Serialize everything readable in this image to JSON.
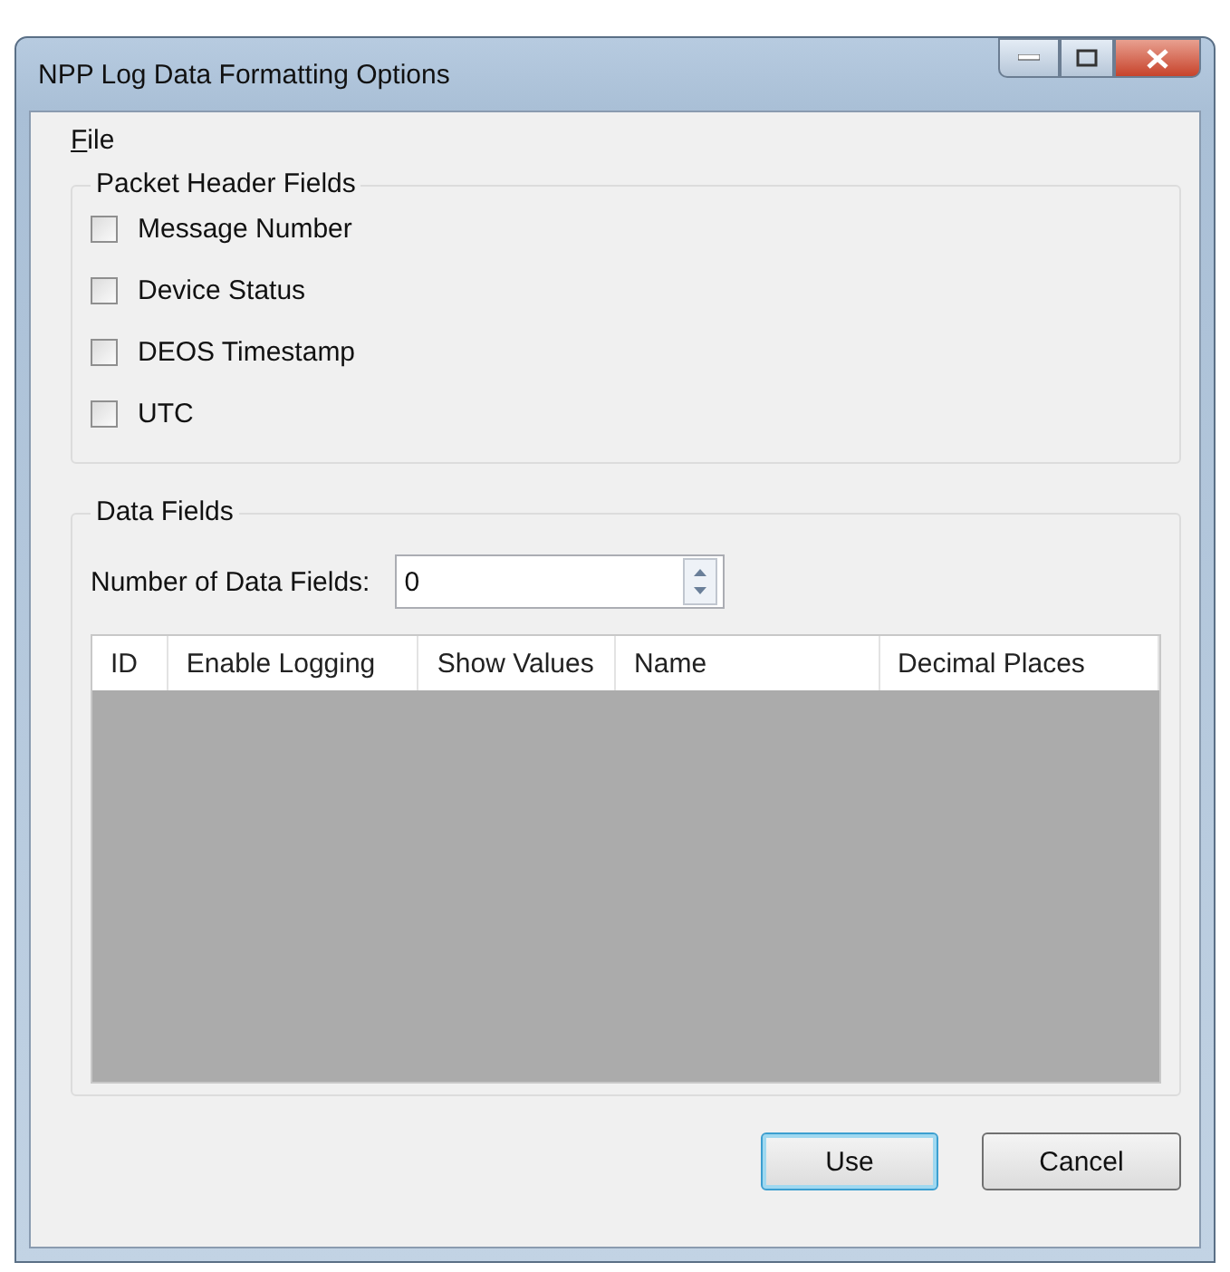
{
  "window": {
    "title": "NPP Log Data Formatting Options"
  },
  "menu": [
    "File"
  ],
  "packet_header": {
    "title": "Packet Header Fields",
    "fields": [
      {
        "label": "Message Number",
        "checked": false
      },
      {
        "label": "Device Status",
        "checked": false
      },
      {
        "label": "DEOS Timestamp",
        "checked": false
      },
      {
        "label": "UTC",
        "checked": false
      }
    ]
  },
  "data_fields": {
    "title": "Data Fields",
    "count_label": "Number of Data Fields:",
    "count_value": "0",
    "table": {
      "columns": [
        "ID",
        "Enable Logging",
        "Show Values",
        "Name",
        "Decimal Places"
      ]
    }
  },
  "buttons": [
    {
      "label": "Use",
      "default": true
    },
    {
      "label": "Cancel",
      "default": false
    }
  ]
}
